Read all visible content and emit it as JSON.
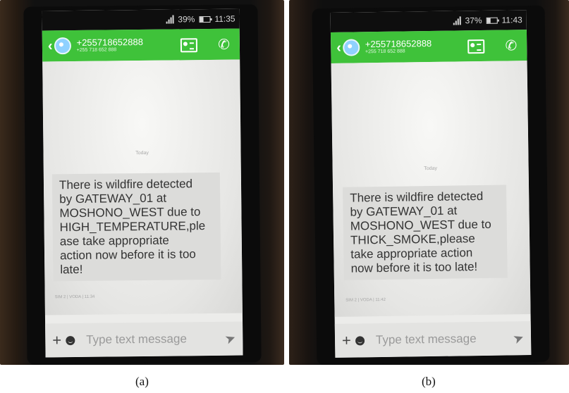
{
  "panels": [
    {
      "status": {
        "battery": "39%",
        "time": "11:35"
      },
      "header": {
        "contact": "+255718652888",
        "sub": "+255 718 652 888"
      },
      "chat": {
        "date_label": "Today",
        "message_lines": [
          "There is wildfire detected",
          "by GATEWAY_01 at",
          "MOSHONO_WEST due to",
          "HIGH_TEMPERATURE,ple",
          "ase take appropriate",
          "action now before it is too",
          "late!"
        ],
        "meta": "SIM 2  |  VODA  |  11:34"
      },
      "composer": {
        "placeholder": "Type text message"
      },
      "caption": "(a)"
    },
    {
      "status": {
        "battery": "37%",
        "time": "11:43"
      },
      "header": {
        "contact": "+255718652888",
        "sub": "+255 718 652 888"
      },
      "chat": {
        "date_label": "Today",
        "message_lines": [
          "There is wildfire detected",
          "by GATEWAY_01 at",
          "MOSHONO_WEST due to",
          "THICK_SMOKE,please",
          "take appropriate action",
          "now before it is too late!"
        ],
        "meta": "SIM 2  |  VODA  |  11:42"
      },
      "composer": {
        "placeholder": "Type text message"
      },
      "caption": "(b)"
    }
  ],
  "colors": {
    "header_green": "#3fc23a",
    "bubble": "#dcdcda"
  },
  "icons": [
    "signal-icon",
    "battery-icon",
    "back-arrow-icon",
    "avatar-icon",
    "contact-card-icon",
    "phone-call-icon",
    "plus-icon",
    "emoji-icon",
    "send-icon"
  ]
}
